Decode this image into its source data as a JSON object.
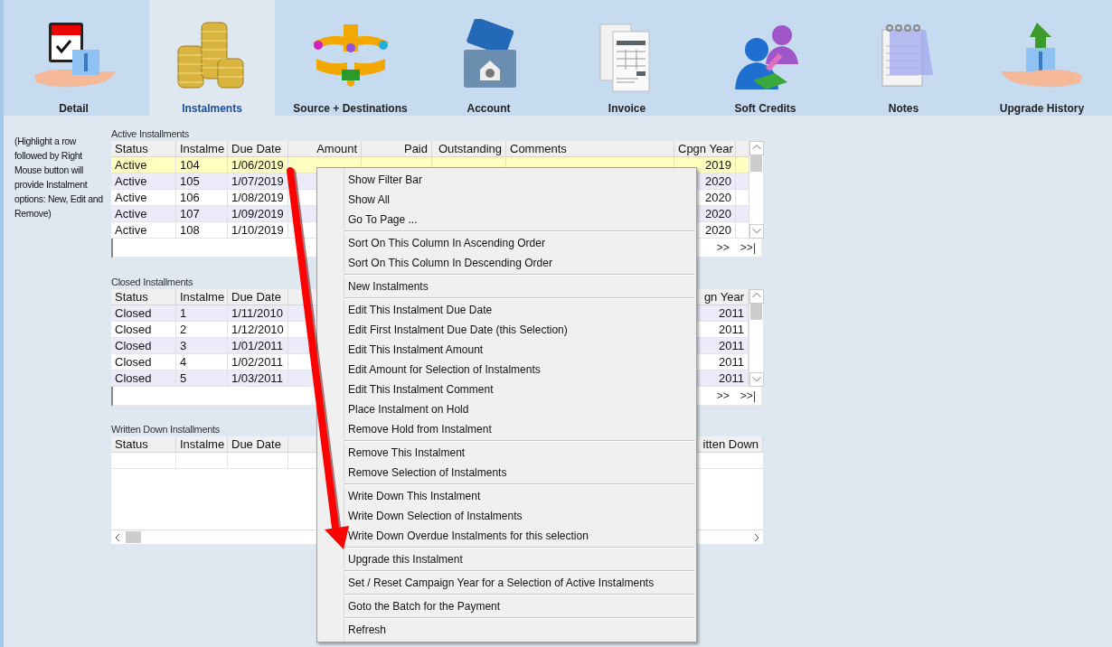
{
  "tabs": [
    {
      "label": "Detail",
      "selected": false
    },
    {
      "label": "Instalments",
      "selected": true
    },
    {
      "label": "Source + Destinations",
      "selected": false
    },
    {
      "label": "Account",
      "selected": false
    },
    {
      "label": "Invoice",
      "selected": false
    },
    {
      "label": "Soft Credits",
      "selected": false
    },
    {
      "label": "Notes",
      "selected": false
    },
    {
      "label": "Upgrade History",
      "selected": false
    }
  ],
  "hint": "(Highlight a row followed by Right Mouse button will provide Instalment options: New, Edit and Remove)",
  "active_installments": {
    "title": "Active Installments",
    "columns": [
      "Status",
      "Instalme",
      "Due Date",
      "Amount",
      "Paid",
      "Outstanding",
      "Comments",
      "Cpgn Year"
    ],
    "rows": [
      {
        "status": "Active",
        "instalment": "104",
        "due_date": "1/06/2019",
        "cpgn_year": "2019",
        "selected": true
      },
      {
        "status": "Active",
        "instalment": "105",
        "due_date": "1/07/2019",
        "cpgn_year": "2020",
        "selected": false
      },
      {
        "status": "Active",
        "instalment": "106",
        "due_date": "1/08/2019",
        "cpgn_year": "2020",
        "selected": false
      },
      {
        "status": "Active",
        "instalment": "107",
        "due_date": "1/09/2019",
        "cpgn_year": "2020",
        "selected": false
      },
      {
        "status": "Active",
        "instalment": "108",
        "due_date": "1/10/2019",
        "cpgn_year": "2020",
        "selected": false
      }
    ],
    "nav": [
      ">>",
      ">>|"
    ]
  },
  "closed_installments": {
    "title": "Closed Installments",
    "columns": [
      "Status",
      "Instalme",
      "Due Date",
      "gn Year"
    ],
    "rows": [
      {
        "status": "Closed",
        "instalment": "1",
        "due_date": "1/11/2010",
        "cpgn_year": "2011",
        "selected": false
      },
      {
        "status": "Closed",
        "instalment": "2",
        "due_date": "1/12/2010",
        "cpgn_year": "2011",
        "selected": false
      },
      {
        "status": "Closed",
        "instalment": "3",
        "due_date": "1/01/2011",
        "cpgn_year": "2011",
        "selected": false
      },
      {
        "status": "Closed",
        "instalment": "4",
        "due_date": "1/02/2011",
        "cpgn_year": "2011",
        "selected": false
      },
      {
        "status": "Closed",
        "instalment": "5",
        "due_date": "1/03/2011",
        "cpgn_year": "2011",
        "selected": false
      }
    ],
    "nav": [
      ">>",
      ">>|"
    ]
  },
  "written_down_installments": {
    "title": "Written Down Installments",
    "columns": [
      "Status",
      "Instalme",
      "Due Date",
      "itten Down"
    ]
  },
  "context_menu": {
    "groups": [
      [
        "Show Filter Bar",
        "Show All",
        "Go To Page ..."
      ],
      [
        "Sort On This Column In Ascending Order",
        "Sort On This Column In Descending Order"
      ],
      [
        "New Instalments"
      ],
      [
        "Edit This Instalment Due Date",
        "Edit First Instalment Due Date (this Selection)",
        "Edit This Instalment Amount",
        "Edit Amount for Selection of Instalments",
        "Edit This Instalment Comment",
        "Place Instalment on Hold",
        "Remove Hold from Instalment"
      ],
      [
        "Remove This Instalment",
        "Remove Selection of Instalments"
      ],
      [
        "Write Down This Instalment",
        "Write Down Selection of Instalments",
        "Write Down Overdue Instalments for this selection"
      ],
      [
        "Upgrade this Instalment"
      ],
      [
        "Set / Reset Campaign Year for a Selection of Active Instalments"
      ],
      [
        "Goto the Batch for the Payment"
      ],
      [
        "Refresh"
      ]
    ]
  }
}
